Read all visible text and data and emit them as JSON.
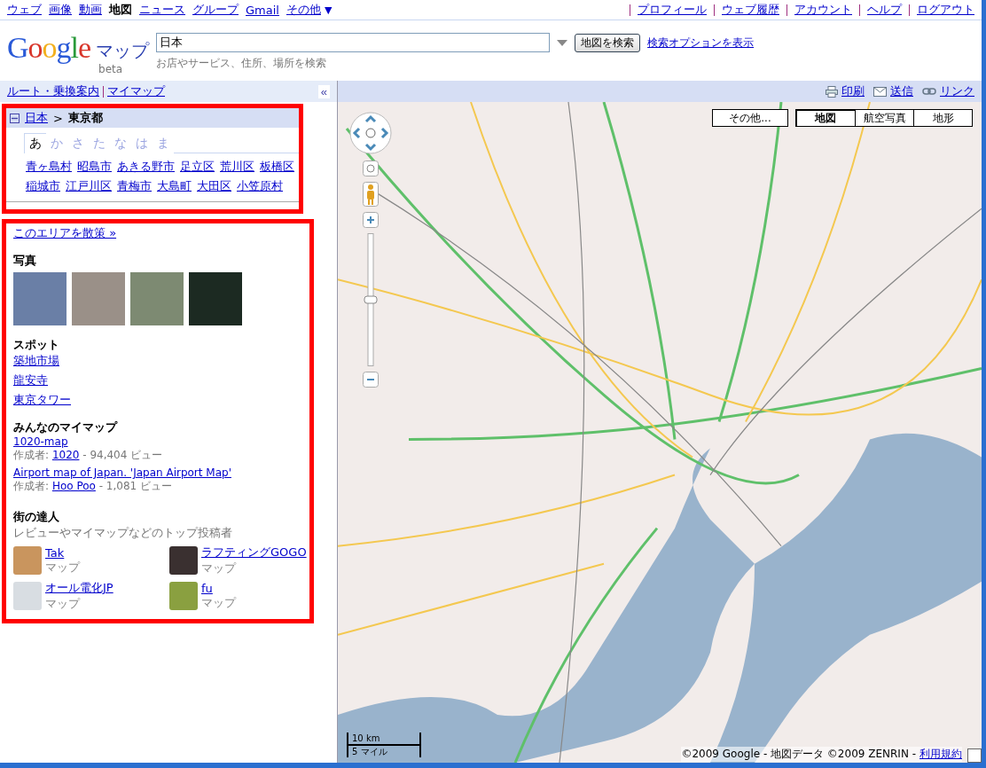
{
  "top_nav": {
    "left": [
      {
        "label": "ウェブ",
        "selected": false
      },
      {
        "label": "画像",
        "selected": false
      },
      {
        "label": "動画",
        "selected": false
      },
      {
        "label": "地図",
        "selected": true
      },
      {
        "label": "ニュース",
        "selected": false
      },
      {
        "label": "グループ",
        "selected": false
      },
      {
        "label": "Gmail",
        "selected": false
      },
      {
        "label": "その他",
        "selected": false
      }
    ],
    "more_caret": "▼",
    "right": [
      "プロフィール",
      "ウェブ履歴",
      "アカウント",
      "ヘルプ",
      "ログアウト"
    ]
  },
  "header": {
    "logo": "Google",
    "product": "マップ",
    "badge": "beta",
    "search": {
      "value": "日本"
    },
    "caption": "お店やサービス、住所、場所を検索",
    "button": "地図を検索",
    "options_link": "検索オプションを表示"
  },
  "toolbar": {
    "left_links": [
      "ルート・乗換案内",
      "マイマップ"
    ],
    "collapse": "«",
    "right_links": [
      {
        "label": "印刷",
        "kind": "print"
      },
      {
        "label": "送信",
        "kind": "mail"
      },
      {
        "label": "リンク",
        "kind": "link"
      }
    ]
  },
  "area": {
    "breadcrumb": {
      "expanded": true,
      "parent": "日本",
      "separator": ">",
      "current": "東京都"
    },
    "kana_tabs": [
      {
        "label": "あ",
        "selected": true
      },
      {
        "label": "か",
        "selected": false
      },
      {
        "label": "さ",
        "selected": false
      },
      {
        "label": "た",
        "selected": false
      },
      {
        "label": "な",
        "selected": false
      },
      {
        "label": "は",
        "selected": false
      },
      {
        "label": "ま",
        "selected": false
      }
    ],
    "places": [
      "青ヶ島村",
      "昭島市",
      "あきる野市",
      "足立区",
      "荒川区",
      "板橋区",
      "稲城市",
      "江戸川区",
      "青梅市",
      "大島町",
      "大田区",
      "小笠原村"
    ]
  },
  "explore_link": "このエリアを散策 »",
  "photos": {
    "title": "写真",
    "items": [
      {
        "kind": "tower"
      },
      {
        "kind": "temple"
      },
      {
        "kind": "shrine"
      },
      {
        "kind": "night"
      }
    ]
  },
  "spots": {
    "title": "スポット",
    "links": [
      "築地市場",
      "龍安寺",
      "東京タワー"
    ]
  },
  "mymaps": {
    "title": "みんなのマイマップ",
    "items": [
      {
        "title": "1020-map",
        "author_label": "作成者:",
        "author": "1020",
        "views": "- 94,404 ビュー"
      },
      {
        "title": "Airport map of Japan. 'Japan Airport Map'",
        "author_label": "作成者:",
        "author": "Hoo Poo",
        "views": "- 1,081 ビュー"
      }
    ]
  },
  "experts": {
    "title": "街の達人",
    "subtitle": "レビューやマイマップなどのトップ投稿者",
    "people": [
      {
        "name": "Tak",
        "label": "マップ"
      },
      {
        "name": "ラフティングGOGO",
        "label": "マップ"
      },
      {
        "name": "オール電化JP",
        "label": "マップ"
      },
      {
        "name": "fu",
        "label": "マップ"
      }
    ]
  },
  "map": {
    "zoom": {
      "level": 0.5
    },
    "more_button": "その他...",
    "types": [
      {
        "label": "地図",
        "selected": true
      },
      {
        "label": "航空写真",
        "selected": false
      },
      {
        "label": "地形",
        "selected": false
      }
    ],
    "scale": {
      "metric": "10 km",
      "imperial": "5 マイル"
    },
    "copyright": "©2009 Google - 地図データ ©2009 ZENRIN -",
    "terms": "利用規約"
  }
}
